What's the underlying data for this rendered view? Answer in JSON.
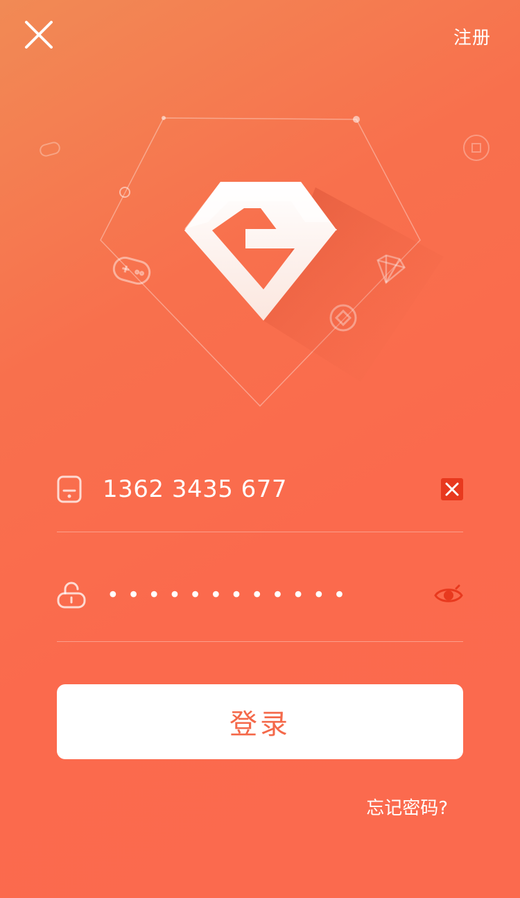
{
  "header": {
    "close_icon": "close-icon",
    "register_label": "注册"
  },
  "logo": {
    "icon": "gem-g-logo",
    "letter": "G",
    "decor_icons": [
      "gamepad-icon",
      "coin-icon",
      "diamond-icon"
    ]
  },
  "form": {
    "phone": {
      "icon": "phone-icon",
      "value": "1362 3435 677",
      "clear_icon": "clear-icon"
    },
    "password": {
      "icon": "lock-icon",
      "masked_value": "••••••••••••",
      "visibility_icon": "eye-icon"
    },
    "login_label": "登录",
    "forgot_label": "忘记密码?"
  },
  "colors": {
    "background_top": "#f18a55",
    "background": "#fb6a4d",
    "button_text": "#f4694a",
    "accent_red": "#e8391e"
  }
}
